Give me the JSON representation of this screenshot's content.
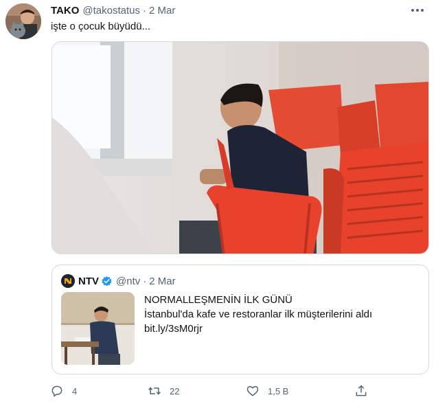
{
  "author": {
    "name": "TAKO",
    "handle": "@takostatus",
    "separator": "·",
    "date": "2 Mar"
  },
  "tweet_text": "işte o çocuk büyüdü...",
  "quoted": {
    "name": "NTV",
    "handle": "@ntv",
    "separator": "·",
    "date": "2 Mar",
    "card_title": "NORMALLEŞMENİN İLK GÜNÜ",
    "card_text": "İstanbul'da kafe ve restoranlar ilk müşterilerini aldı",
    "card_link": "bit.ly/3sM0rjr"
  },
  "actions": {
    "replies": "4",
    "retweets": "22",
    "likes": "1,5 B"
  },
  "icons": {
    "avatar": "profile-photo",
    "more": "more-icon",
    "verified": "verified-badge-icon",
    "reply": "reply-icon",
    "retweet": "retweet-icon",
    "like": "heart-icon",
    "share": "share-icon"
  },
  "colors": {
    "text": "#0f1419",
    "secondary": "#536471",
    "border": "#cfd9de",
    "verified": "#1d9bf0",
    "chair": "#e8412c"
  }
}
